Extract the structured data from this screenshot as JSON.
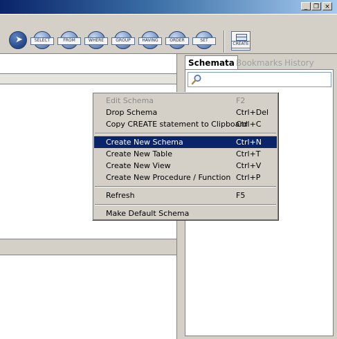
{
  "window": {
    "buttons": [
      {
        "name": "minimize",
        "glyph": "_"
      },
      {
        "name": "restore",
        "glyph": "❐"
      },
      {
        "name": "close",
        "glyph": "×"
      }
    ]
  },
  "toolbar": {
    "tools": [
      {
        "label": "SELECT"
      },
      {
        "label": "FROM"
      },
      {
        "label": "WHERE"
      },
      {
        "label": "GROUP"
      },
      {
        "label": "HAVING"
      },
      {
        "label": "ORDER"
      },
      {
        "label": "SET"
      }
    ],
    "create_label": "CREATE"
  },
  "right_panel": {
    "tabs": [
      {
        "label": "Schemata",
        "active": true
      },
      {
        "label": "Bookmarks",
        "active": false
      },
      {
        "label": "History",
        "active": false
      }
    ]
  },
  "context_menu": {
    "items": [
      {
        "label": "Edit Schema",
        "shortcut": "F2",
        "disabled": true
      },
      {
        "label": "Drop Schema",
        "shortcut": "Ctrl+Del"
      },
      {
        "label": "Copy CREATE statement to Clipboard",
        "shortcut": "Ctrl+C"
      },
      {
        "label": "Create New Schema",
        "shortcut": "Ctrl+N",
        "highlighted": true
      },
      {
        "label": "Create New Table",
        "shortcut": "Ctrl+T"
      },
      {
        "label": "Create New View",
        "shortcut": "Ctrl+V"
      },
      {
        "label": "Create New Procedure / Function",
        "shortcut": "Ctrl+P"
      },
      {
        "label": "Refresh",
        "shortcut": "F5"
      },
      {
        "label": "Make Default Schema",
        "shortcut": ""
      }
    ]
  },
  "colors": {
    "menu_highlight": "#0a246a",
    "chrome": "#d4d0c8"
  }
}
